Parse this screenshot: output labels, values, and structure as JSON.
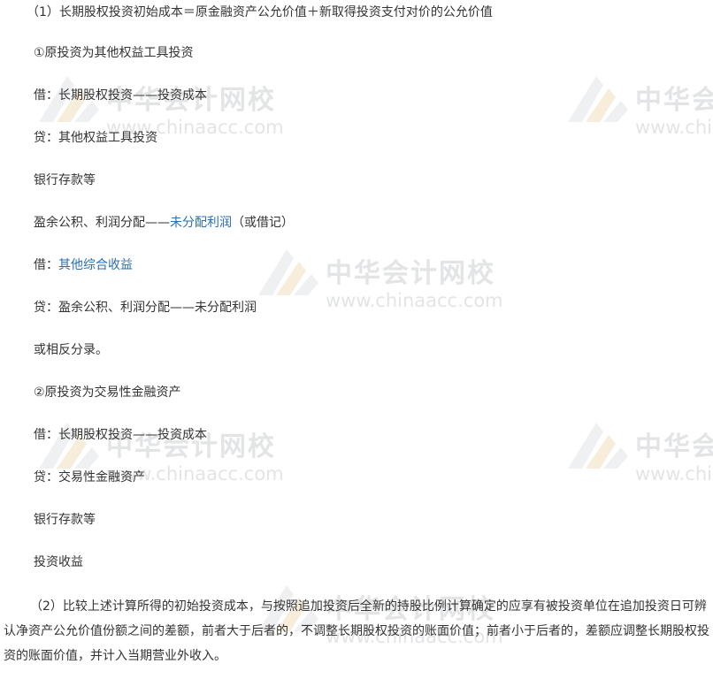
{
  "watermark": {
    "name": "中华会计网校",
    "url": "www.chinaacc.com"
  },
  "lines": {
    "l1": "（1）长期股权投资初始成本＝原金融资产公允价值＋新取得投资支付对价的公允价值",
    "l2": "①原投资为其他权益工具投资",
    "l3": "借：长期股权投资——投资成本",
    "l4": "贷：其他权益工具投资",
    "l5": "银行存款等",
    "l6a": "盈余公积、利润分配——",
    "l6b": "未分配利润",
    "l6c": "（或借记）",
    "l7a": "借：",
    "l7b": "其他综合收益",
    "l8": "贷：盈余公积、利润分配——未分配利润",
    "l9": "或相反分录。",
    "l10": "②原投资为交易性金融资产",
    "l11": "借：长期股权投资——投资成本",
    "l12": "贷：交易性金融资产",
    "l13": "银行存款等",
    "l14": "投资收益",
    "p2": "（2）比较上述计算所得的初始投资成本，与按照追加投资后全新的持股比例计算确定的应享有被投资单位在追加投资日可辨认净资产公允价值份额之间的差额，前者大于后者的，不调整长期股权投资的账面价值；前者小于后者的，差额应调整长期股权投资的账面价值，并计入当期营业外收入。"
  }
}
